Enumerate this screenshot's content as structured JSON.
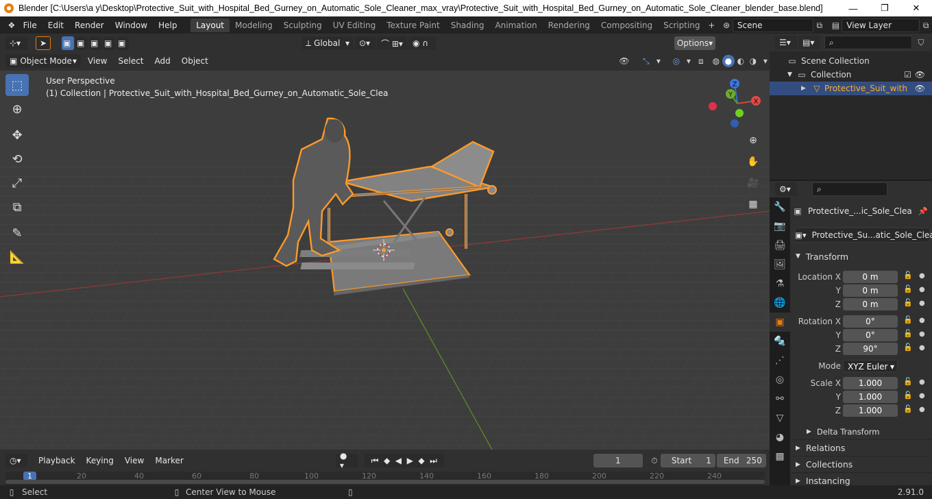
{
  "window": {
    "title": "Blender [C:\\Users\\a y\\Desktop\\Protective_Suit_with_Hospital_Bed_Gurney_on_Automatic_Sole_Cleaner_max_vray\\Protective_Suit_with_Hospital_Bed_Gurney_on_Automatic_Sole_Cleaner_blender_base.blend]",
    "minimize": "—",
    "maximize": "❐",
    "close": "✕"
  },
  "menu": [
    "File",
    "Edit",
    "Render",
    "Window",
    "Help"
  ],
  "workspaces": [
    "Layout",
    "Modeling",
    "Sculpting",
    "UV Editing",
    "Texture Paint",
    "Shading",
    "Animation",
    "Rendering",
    "Compositing",
    "Scripting"
  ],
  "active_workspace": "Layout",
  "scene": {
    "label": "Scene",
    "view_layer": "View Layer"
  },
  "header": {
    "orientation": "Global",
    "options": "Options",
    "mode": "Object Mode",
    "menus": [
      "View",
      "Select",
      "Add",
      "Object"
    ]
  },
  "viewport": {
    "perspective": "User Perspective",
    "collection_info": "(1) Collection | Protective_Suit_with_Hospital_Bed_Gurney_on_Automatic_Sole_Clea",
    "gizmo": {
      "x": "X",
      "y": "Y",
      "z": "Z"
    }
  },
  "timeline": {
    "menus": [
      "Playback",
      "Keying",
      "View",
      "Marker"
    ],
    "current_frame": "1",
    "start_label": "Start",
    "start": "1",
    "end_label": "End",
    "end": "250",
    "ruler": [
      "1",
      "20",
      "40",
      "60",
      "80",
      "100",
      "120",
      "140",
      "160",
      "180",
      "200",
      "220",
      "240"
    ]
  },
  "status": {
    "select": "Select",
    "center": "Center View to Mouse",
    "version": "2.91.0"
  },
  "outliner": {
    "scene_collection": "Scene Collection",
    "collection": "Collection",
    "object": "Protective_Suit_with"
  },
  "properties": {
    "object_name": "Protective_...ic_Sole_Clea",
    "data_name": "Protective_Su...atic_Sole_Clea",
    "transform_title": "Transform",
    "location_label": "Location X",
    "rotation_label": "Rotation X",
    "scale_label": "Scale X",
    "y_label": "Y",
    "z_label": "Z",
    "location": [
      "0 m",
      "0 m",
      "0 m"
    ],
    "rotation": [
      "0°",
      "0°",
      "90°"
    ],
    "mode_label": "Mode",
    "mode_value": "XYZ Euler",
    "scale": [
      "1.000",
      "1.000",
      "1.000"
    ],
    "delta_transform": "Delta Transform",
    "relations": "Relations",
    "collections": "Collections",
    "instancing": "Instancing"
  }
}
